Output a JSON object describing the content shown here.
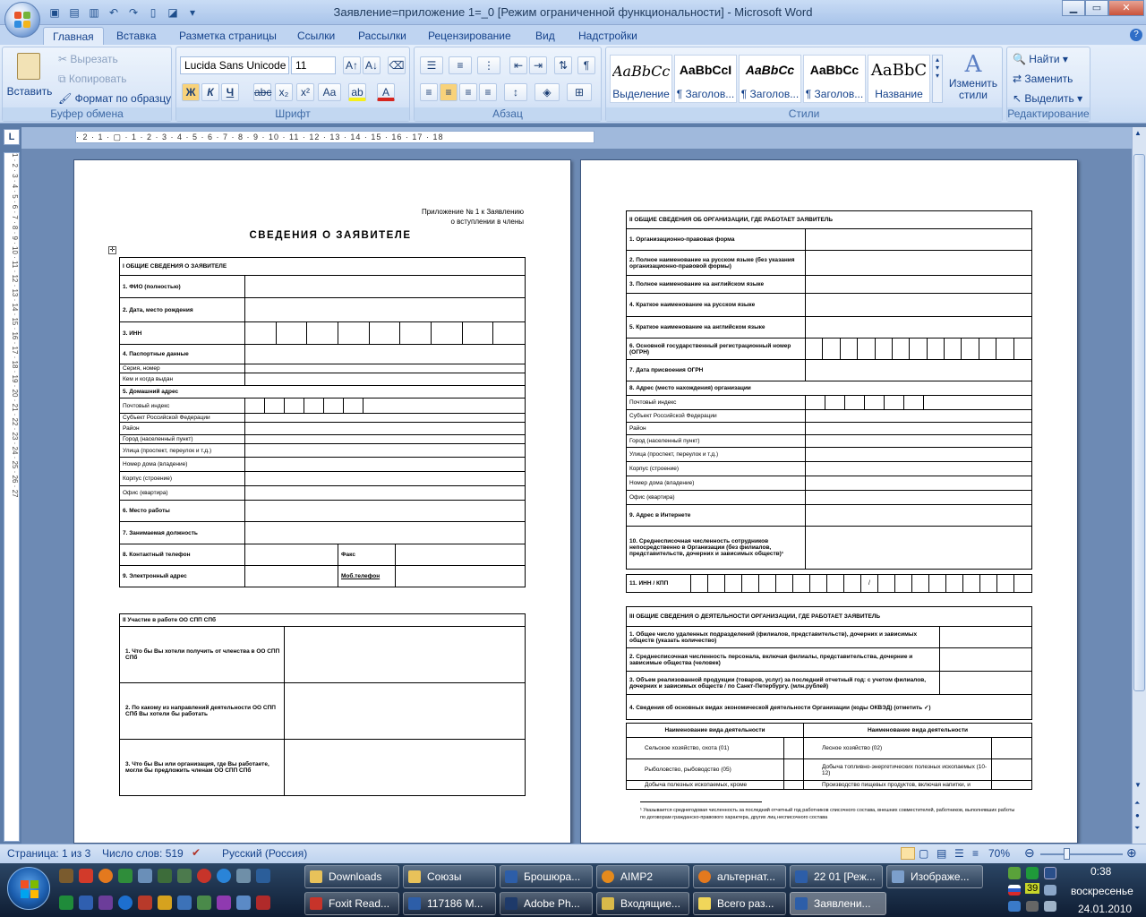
{
  "window": {
    "title": "Заявление=приложение 1=_0 [Режим ограниченной функциональности] - Microsoft Word"
  },
  "ribbon_tabs": [
    "Главная",
    "Вставка",
    "Разметка страницы",
    "Ссылки",
    "Рассылки",
    "Рецензирование",
    "Вид",
    "Надстройки"
  ],
  "clipboard": {
    "paste": "Вставить",
    "cut": "Вырезать",
    "copy": "Копировать",
    "format_painter": "Формат по образцу",
    "label": "Буфер обмена"
  },
  "font": {
    "name": "Lucida Sans Unicode",
    "size": "11",
    "label": "Шрифт",
    "bold": "Ж",
    "italic": "К",
    "underline": "Ч"
  },
  "paragraph": {
    "label": "Абзац"
  },
  "styles": {
    "label": "Стили",
    "items": [
      {
        "preview": "AaBbCcI",
        "name": "Выделение"
      },
      {
        "preview": "AaBbCcI",
        "name": "¶ Заголов..."
      },
      {
        "preview": "AaBbCc",
        "name": "¶ Заголов..."
      },
      {
        "preview": "AaBbCc",
        "name": "¶ Заголов..."
      },
      {
        "preview": "AaBbC",
        "name": "Название"
      }
    ],
    "change": "Изменить стили"
  },
  "editing": {
    "find": "Найти",
    "replace": "Заменить",
    "select": "Выделить",
    "label": "Редактирование"
  },
  "ruler": {
    "marks": "· 2 · 1 · ▢ · 1 · 2 · 3 · 4 · 5 · 6 · 7 · 8 · 9 · 10 · 11 · 12 · 13 · 14 · 15 · 16 · 17 · 18"
  },
  "vruler": {
    "marks": "1 · 2 · 3 · 4 · 5 · 6 · 7 · 8 · 9 · 10 · 11 · 12 · 13 · 14 · 15 · 16 · 17 · 18 · 19 · 20 · 21 · 22 · 23 · 24 · 25 · 26 · 27"
  },
  "page1": {
    "appendix_1": "Приложение № 1 к Заявлению",
    "appendix_2": "о вступлении в члены",
    "heading": "СВЕДЕНИЯ О ЗАЯВИТЕЛЕ",
    "section1": "I    ОБЩИЕ СВЕДЕНИЯ  О ЗАЯВИТЕЛЕ",
    "rows": [
      "1. ФИО (полностью)",
      "2. Дата, место рождения",
      "3.  ИНН",
      "4. Паспортные данные",
      "Серия, номер",
      "Кем и когда выдан",
      "5. Домашний адрес",
      "Почтовый индекс",
      "Субъект Российской Федерации",
      "Район",
      "Город (населенный пункт)",
      "Улица (проспект, переулок и т.д.)",
      "Номер дома (владение)",
      "Корпус (строение)",
      "Офис (квартира)",
      "6. Место работы",
      "7. Занимаемая должность",
      "8. Контактный телефон",
      "9. Электронный адрес"
    ],
    "fax": "Факс",
    "mobile": "Моб.телефон",
    "section2": "II Участие в работе ОО СПП СПб",
    "q1": "1. Что бы Вы хотели получить от членства  в ОО СПП СПб",
    "q2": "2. По какому из направлений деятельности ОО СПП СПб Вы хотели бы работать",
    "q3": "3. Что бы Вы или организация, где Вы работаете, могли бы предложить  членам ОО СПП СПб"
  },
  "page2": {
    "section2": "II   ОБЩИЕ СВЕДЕНИЯ  ОБ ОРГАНИЗАЦИИ,  ГДЕ  РАБОТАЕТ ЗАЯВИТЕЛЬ",
    "rows": [
      "1. Организационно-правовая форма",
      "2. Полное наименование на русском языке  (без указания организационно-правовой формы)",
      "3. Полное наименование на английском языке",
      "4. Краткое наименование на русском языке",
      "5. Краткое наименование на английском языке",
      "6. Основной государственный регистрационный номер (ОГРН)",
      "7. Дата присвоения ОГРН",
      "8. Адрес (место нахождения) организации",
      "Почтовый индекс",
      "Субъект Российской Федерации",
      "Район",
      "Город (населенный  пункт)",
      "Улица (проспект, переулок и т.д.)",
      "Корпус (строение)",
      "Номер дома (владение)",
      "Офис (квартира)",
      "9.  Адрес в   Интернете",
      "10.  Среднесписочная численность сотрудников непосредственно в Организации (без филиалов, представительств, дочерних и зависимых обществ)¹",
      "11.  ИНН / КПП"
    ],
    "slash": "/",
    "section3": "III  ОБЩИЕ СВЕДЕНИЯ  О ДЕЯТЕЛЬНОСТИ  ОРГАНИЗАЦИИ,  ГДЕ  РАБОТАЕТ ЗАЯВИТЕЛЬ",
    "s3rows": [
      "1. Общее число удаленных подразделений (филиалов, представительств), дочерних и зависимых обществ (указать количество)",
      "2. Среднесписочная численность персонала, включая филиалы, представительства, дочерние и зависимые общества (человек)",
      "3. Объем реализованной продукции  (товаров, услуг) за последний отчетный год: с учетом филиалов, дочерних  и зависимых обществ / по Санкт-Петербургу. (млн.рублей)",
      "4. Сведения об основных видах экономической деятельности Организации (коды  ОКВЭД) (отметить   ✓)"
    ],
    "col_head": "Наименование вида деятельности",
    "activities_left": [
      "Сельское хозяйство, охота (01)",
      "Рыболовство, рыбоводство (05)",
      "Добыча полезных ископаемых, кроме"
    ],
    "activities_right": [
      "Лесное хозяйство (02)",
      "Добыча топливно-энергетических полезных ископаемых (10-12)",
      "Производство пищевых продуктов, включая напитки, и"
    ],
    "footnote": "¹ Указывается среднегодовая  численность  за последний  отчетный год работников списочного состава, внешних совместителей,  работников, выполнявших  работы  по договорам  гражданско-правового  характера,  других лиц несписочного  состава"
  },
  "status": {
    "page": "Страница: 1 из 3",
    "words": "Число слов: 519",
    "lang": "Русский (Россия)",
    "zoom": "70%"
  },
  "taskbar": {
    "row1": [
      "Downloads",
      "Союзы",
      "Брошюра...",
      "AIMP2",
      "альтернат...",
      "22 01 [Реж...",
      "Изображе..."
    ],
    "row2": [
      "Foxit Read...",
      "117186 М...",
      "Adobe Ph...",
      "Входящие...",
      "Всего раз...",
      "Заявлени..."
    ],
    "time": "0:38",
    "day": "воскресенье",
    "date": "24.01.2010",
    "tray_num": "39"
  }
}
